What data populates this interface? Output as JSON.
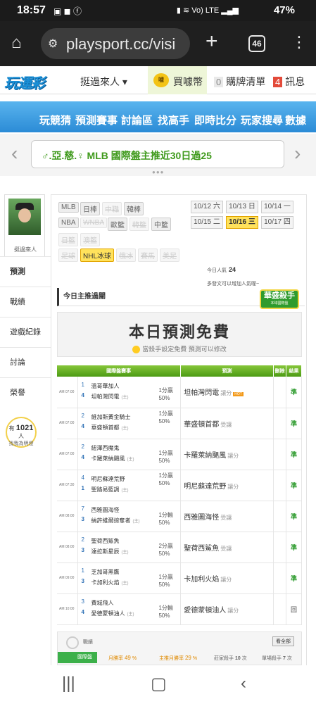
{
  "status": {
    "time": "18:57",
    "battery": "47%",
    "net1": "Vo)",
    "net2": "LTE"
  },
  "browser": {
    "url": "playsport.cc/visi",
    "tabs": "46"
  },
  "site": {
    "logo": "玩運彩",
    "user": "挺過來人 ▾",
    "coins": "買噱幣",
    "coin_icon": "噱",
    "cart_count": "0",
    "cart": "購牌清單",
    "msg_count": "4",
    "msg": "訊息"
  },
  "nav": [
    "玩競猜",
    "預測賽事",
    "討論區",
    "找高手",
    "即時比分",
    "玩家搜尋",
    "數據"
  ],
  "marquee": "♂.亞.慈.♀ MLB 國際盤主推近30日過25",
  "profile": {
    "name": "挺過來人"
  },
  "menu": [
    "預測",
    "戰績",
    "遊戲紀錄",
    "討論",
    "榮譽"
  ],
  "tip": {
    "pre": "有",
    "count": "1021",
    "post": "人",
    "line2": "找我為明燈"
  },
  "sports": {
    "r1": [
      {
        "t": "MLB",
        "s": ""
      },
      {
        "t": "日棒",
        "s": ""
      },
      {
        "t": "中職",
        "s": "dis"
      },
      {
        "t": "韓棒",
        "s": ""
      }
    ],
    "r2": [
      {
        "t": "NBA",
        "s": ""
      },
      {
        "t": "WNBA",
        "s": "dis"
      },
      {
        "t": "歐籃",
        "s": ""
      },
      {
        "t": "韓籃",
        "s": "dis"
      },
      {
        "t": "中籃",
        "s": ""
      }
    ],
    "r3": [
      {
        "t": "日籃",
        "s": "dis"
      },
      {
        "t": "澳籃",
        "s": "dis"
      }
    ],
    "r4": [
      {
        "t": "足球",
        "s": "dis"
      },
      {
        "t": "NHL冰球",
        "s": "sel"
      },
      {
        "t": "俄冰",
        "s": "dis"
      },
      {
        "t": "賽馬",
        "s": "dis"
      },
      {
        "t": "美足",
        "s": "dis"
      }
    ]
  },
  "dates": [
    {
      "t": "10/12 六",
      "s": ""
    },
    {
      "t": "10/13 日",
      "s": ""
    },
    {
      "t": "10/14 一",
      "s": ""
    },
    {
      "t": "10/15 二",
      "s": ""
    },
    {
      "t": "10/16 三",
      "s": "sel"
    },
    {
      "t": "10/17 四",
      "s": ""
    }
  ],
  "popularity": {
    "label": "今日人氣",
    "value": "24",
    "note": "多發文可以增加人氣喔~"
  },
  "section_title": "今日主推過關",
  "badge": {
    "title": "華盛殺手",
    "sub": "本球國際盤"
  },
  "banner": {
    "title": "本日預測免費",
    "sub": "當殺手設定免費 預測可以修改"
  },
  "table": {
    "headers": [
      "國際盤賽事",
      "預測",
      "刪除",
      "結果"
    ],
    "rows": [
      {
        "time": "AM 07:00",
        "away_no": "1",
        "away": "溫哥華加人",
        "home_no": "4",
        "home": "坦帕灣閃電",
        "home_mark": "(主)",
        "hc": "1分贏",
        "pct": "50%",
        "hc_row": "home",
        "pick": "坦帕灣閃電",
        "side": "讓分",
        "hot": "HOT",
        "result": "準"
      },
      {
        "time": "AM 07:00",
        "away_no": "2",
        "away": "維加斯黃金騎士",
        "home_no": "4",
        "home": "華盛頓首都",
        "home_mark": "(主)",
        "hc": "1分贏",
        "pct": "50%",
        "hc_row": "away",
        "pick": "華盛頓首都",
        "side": "受讓",
        "hot": "",
        "result": "準"
      },
      {
        "time": "AM 07:00",
        "away_no": "2",
        "away": "紐澤西魔鬼",
        "home_no": "4",
        "home": "卡羅萊納颶風",
        "home_mark": "(主)",
        "hc": "1分贏",
        "pct": "50%",
        "hc_row": "home",
        "pick": "卡羅萊納颶風",
        "side": "讓分",
        "hot": "",
        "result": "準"
      },
      {
        "time": "AM 07:30",
        "away_no": "4",
        "away": "明尼蘇達荒野",
        "home_no": "1",
        "home": "聖路易藍調",
        "home_mark": "(主)",
        "hc": "1分贏",
        "pct": "50%",
        "hc_row": "away",
        "pick": "明尼蘇達荒野",
        "side": "讓分",
        "hot": "",
        "result": "準"
      },
      {
        "time": "AM 08:00",
        "away_no": "7",
        "away": "西雅圖海怪",
        "home_no": "3",
        "home": "納許維爾掠奪者",
        "home_mark": "(主)",
        "hc": "1分輸",
        "pct": "50%",
        "hc_row": "home",
        "pick": "西雅圖海怪",
        "side": "受讓",
        "hot": "",
        "result": "準"
      },
      {
        "time": "AM 08:00",
        "away_no": "2",
        "away": "聖荷西鯊魚",
        "home_no": "3",
        "home": "達拉斯星辰",
        "home_mark": "(主)",
        "hc": "2分贏",
        "pct": "50%",
        "hc_row": "home",
        "pick": "聖荷西鯊魚",
        "side": "受讓",
        "hot": "",
        "result": "準"
      },
      {
        "time": "AM 09:00",
        "away_no": "1",
        "away": "芝加哥黑鷹",
        "home_no": "3",
        "home": "卡加利火焰",
        "home_mark": "(主)",
        "hc": "1分贏",
        "pct": "50%",
        "hc_row": "home",
        "pick": "卡加利火焰",
        "side": "讓分",
        "hot": "",
        "result": "準"
      },
      {
        "time": "AM 10:00",
        "away_no": "3",
        "away": "費城飛人",
        "home_no": "4",
        "home": "愛德蒙頓油人",
        "home_mark": "(主)",
        "hc": "1分輸",
        "pct": "50%",
        "hc_row": "home",
        "pick": "愛德蒙頓油人",
        "side": "讓分",
        "hot": "",
        "result": "回"
      }
    ]
  },
  "record": {
    "title": "戰績",
    "more": "看全部",
    "tag": "國際盤",
    "s1_label": "月勝率",
    "s1_val": "49",
    "s1_unit": "%",
    "s2_label": "主推月勝率",
    "s2_val": "29",
    "s2_unit": "%",
    "s3_label": "莊家殺手",
    "s3_val": "10",
    "s3_unit": "次",
    "s4_label": "單場殺手",
    "s4_val": "7",
    "s4_unit": "次"
  }
}
